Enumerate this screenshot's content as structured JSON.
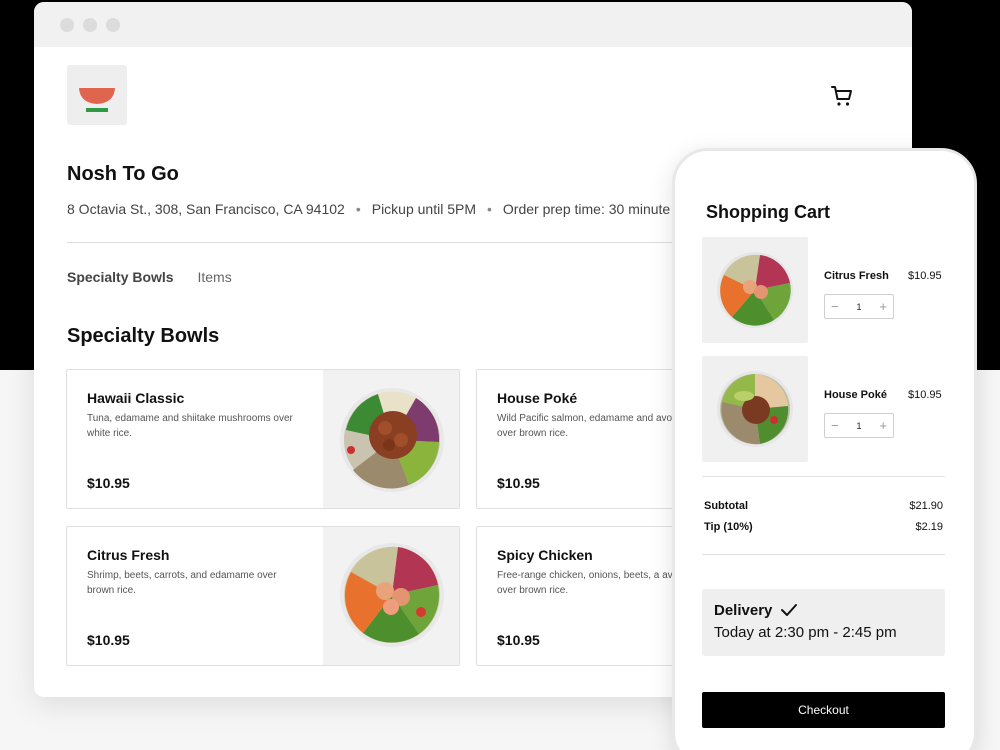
{
  "store": {
    "name": "Nosh To Go",
    "address": "8 Octavia St., 308, San Francisco, CA 94102",
    "pickup": "Pickup until 5PM",
    "prep_time": "Order prep time: 30 minute"
  },
  "nav": {
    "tabs": [
      "Specialty Bowls",
      "Items"
    ]
  },
  "section_title": "Specialty Bowls",
  "menu_items": [
    {
      "name": "Hawaii Classic",
      "description": "Tuna, edamame and shiitake mushrooms over white rice.",
      "price": "$10.95"
    },
    {
      "name": "House Poké",
      "description": "Wild Pacific salmon, edamame and avocado over brown rice.",
      "price": "$10.95"
    },
    {
      "name": "Citrus Fresh",
      "description": "Shrimp, beets, carrots, and edamame over brown rice.",
      "price": "$10.95"
    },
    {
      "name": "Spicy Chicken",
      "description": "Free-range chicken, onions, beets, a avocado over brown rice.",
      "price": "$10.95"
    }
  ],
  "cart": {
    "title": "Shopping Cart",
    "items": [
      {
        "name": "Citrus Fresh",
        "price": "$10.95",
        "quantity": "1"
      },
      {
        "name": "House Poké",
        "price": "$10.95",
        "quantity": "1"
      }
    ],
    "subtotal_label": "Subtotal",
    "subtotal_value": "$21.90",
    "tip_label": "Tip (10%)",
    "tip_value": "$2.19",
    "delivery_title": "Delivery",
    "delivery_time": "Today at 2:30 pm - 2:45 pm",
    "checkout_label": "Checkout"
  },
  "colors": {
    "logo_bowl": "#e0654f",
    "logo_base": "#2e9a44",
    "checkout_bg": "#000000"
  }
}
